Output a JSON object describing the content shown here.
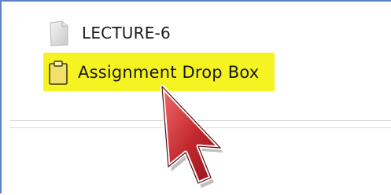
{
  "list": {
    "items": [
      {
        "label": "LECTURE-6",
        "icon": "document-icon",
        "selected": false
      },
      {
        "label": "Assignment Drop Box",
        "icon": "clipboard-icon",
        "selected": true
      }
    ]
  },
  "colors": {
    "highlight": "#f5f321",
    "frame_border": "#5b83c4",
    "cursor": "#c0272d",
    "clipboard_fill": "#f2e06a"
  },
  "overlay": {
    "cursor_icon": "pointer-arrow-icon"
  }
}
